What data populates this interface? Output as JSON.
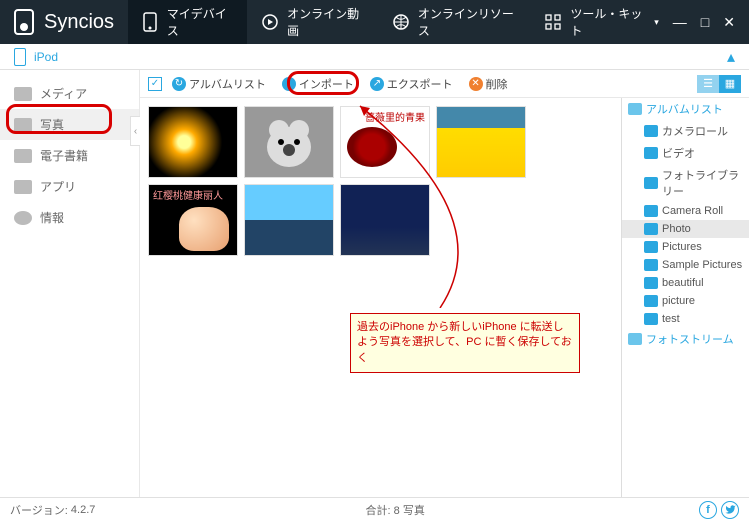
{
  "app_name": "Syncios",
  "nav": [
    {
      "label": "マイデバイス",
      "icon": "device-icon",
      "active": true
    },
    {
      "label": "オンライン動画",
      "icon": "play-icon",
      "active": false
    },
    {
      "label": "オンラインリソース",
      "icon": "globe-icon",
      "active": false
    },
    {
      "label": "ツール・キット",
      "icon": "toolkit-icon",
      "active": false
    }
  ],
  "device": {
    "name": "iPod"
  },
  "sidebar": [
    {
      "label": "メディア",
      "selected": false
    },
    {
      "label": "写真",
      "selected": true
    },
    {
      "label": "電子書籍",
      "selected": false
    },
    {
      "label": "アプリ",
      "selected": false
    },
    {
      "label": "情報",
      "selected": false
    }
  ],
  "toolbar": {
    "albumlist": "アルバムリスト",
    "import": "インポート",
    "export": "エクスポート",
    "delete": "削除"
  },
  "thumbs": [
    {
      "caption": "",
      "class": "t1"
    },
    {
      "caption": "",
      "class": "t2"
    },
    {
      "caption": "蔷薇里的青果",
      "class": "t3"
    },
    {
      "caption": "",
      "class": "t4"
    },
    {
      "caption": "红樱桃健康丽人",
      "class": "t5"
    },
    {
      "caption": "",
      "class": "t6"
    },
    {
      "caption": "",
      "class": "t7"
    }
  ],
  "annotation": "過去のiPhone から新しいiPhone に転送しよう写真を選択して、PC に暫く保存しておく",
  "tree": {
    "albumlist": "アルバムリスト",
    "items": [
      {
        "label": "カメラロール"
      },
      {
        "label": "ビデオ"
      },
      {
        "label": "フォトライブラリー"
      },
      {
        "label": "Camera Roll"
      },
      {
        "label": "Photo",
        "selected": true
      },
      {
        "label": "Pictures"
      },
      {
        "label": "Sample Pictures"
      },
      {
        "label": "beautiful"
      },
      {
        "label": "picture"
      },
      {
        "label": "test"
      }
    ],
    "photostream": "フォトストリーム"
  },
  "status": {
    "version_label": "バージョン:",
    "version": "4.2.7",
    "count_label": "合計:",
    "count": "8 写真"
  }
}
